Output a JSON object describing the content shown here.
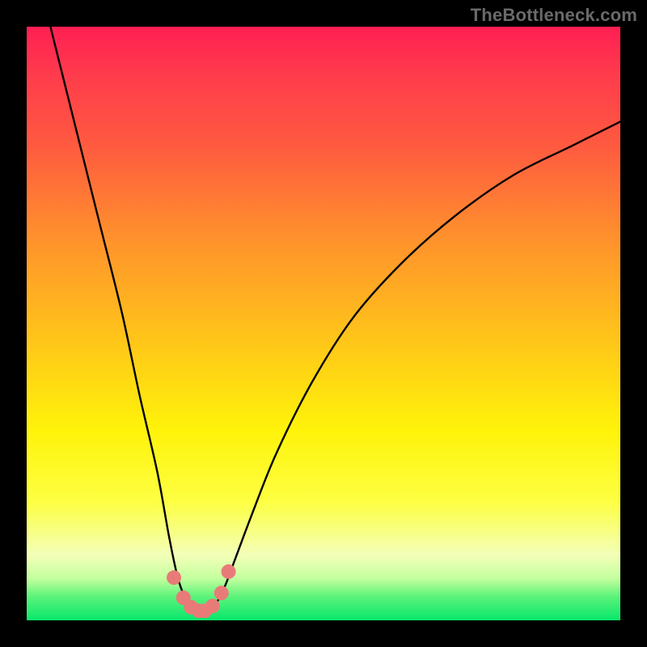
{
  "watermark": "TheBottleneck.com",
  "chart_data": {
    "type": "line",
    "title": "",
    "xlabel": "",
    "ylabel": "",
    "xlim": [
      0,
      100
    ],
    "ylim": [
      0,
      100
    ],
    "grid": false,
    "series": [
      {
        "name": "bottleneck-curve",
        "x": [
          4,
          8,
          12,
          16,
          19,
          22,
          24,
          25.5,
          27,
          28,
          29,
          30.5,
          32,
          33.5,
          35,
          38,
          42,
          48,
          55,
          63,
          72,
          82,
          92,
          100
        ],
        "values": [
          100,
          84,
          68,
          52,
          38,
          25,
          14,
          7,
          3,
          1.5,
          1.2,
          1.5,
          3,
          6,
          10,
          18,
          28,
          40,
          51,
          60,
          68,
          75,
          80,
          84
        ]
      }
    ],
    "markers": {
      "name": "trough-points",
      "color": "#e87b78",
      "radius_outer": 9,
      "radius_inner": 7,
      "points": [
        {
          "x": 24.8,
          "y": 7.2
        },
        {
          "x": 26.4,
          "y": 3.8
        },
        {
          "x": 27.7,
          "y": 2.2
        },
        {
          "x": 29.0,
          "y": 1.6
        },
        {
          "x": 30.0,
          "y": 1.6
        },
        {
          "x": 31.3,
          "y": 2.4
        },
        {
          "x": 32.8,
          "y": 4.6
        },
        {
          "x": 34.0,
          "y": 8.2
        }
      ]
    }
  },
  "colors": {
    "background": "#000000",
    "curve_stroke": "#000000",
    "marker_fill": "#e87b78"
  }
}
